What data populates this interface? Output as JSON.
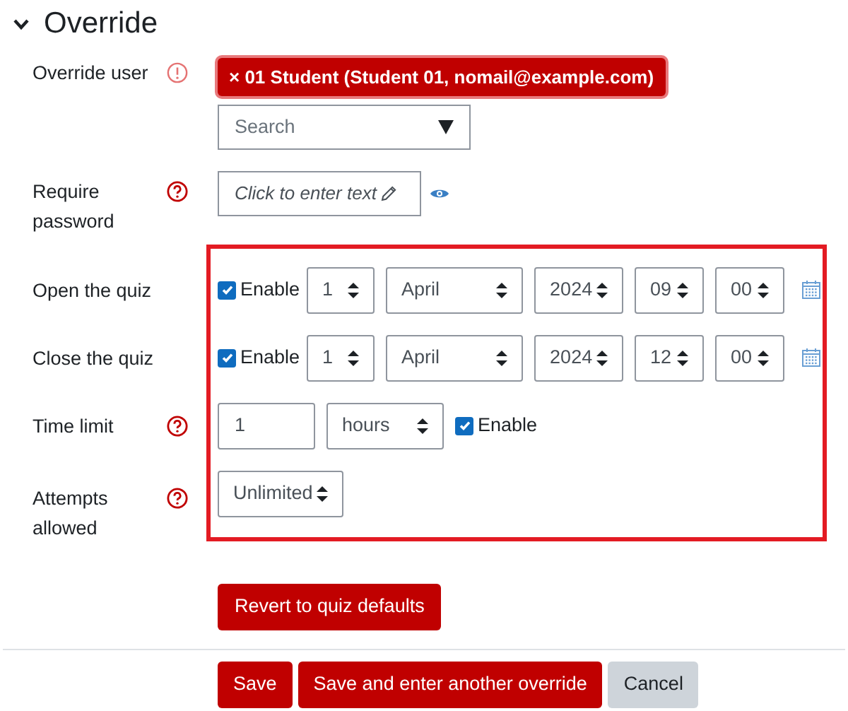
{
  "section": {
    "title": "Override",
    "expanded": true
  },
  "override_user": {
    "label": "Override user",
    "required": true,
    "selected_user": "× 01 Student (Student 01, nomail@example.com)",
    "search": {
      "placeholder": "Search"
    }
  },
  "require_password": {
    "label": "Require password",
    "help": true,
    "placeholder": "Click to enter text"
  },
  "highlighted": true,
  "timing_rows": [
    {
      "kind": "date",
      "label": "Open the quiz",
      "enable": {
        "label": "Enable",
        "checked": true
      },
      "day": "1",
      "month": "April",
      "year": "2024",
      "hour": "09",
      "minute": "00"
    },
    {
      "kind": "date",
      "label": "Close the quiz",
      "enable": {
        "label": "Enable",
        "checked": true
      },
      "day": "1",
      "month": "April",
      "year": "2024",
      "hour": "12",
      "minute": "00"
    },
    {
      "kind": "duration",
      "label": "Time limit",
      "help": true,
      "value": "1",
      "unit": "hours",
      "enable": {
        "label": "Enable",
        "checked": true
      }
    },
    {
      "kind": "attempts",
      "label": "Attempts allowed",
      "help": true,
      "value": "Unlimited"
    }
  ],
  "revert_button": "Revert to quiz defaults",
  "footer_buttons": [
    {
      "label": "Save",
      "kind": "primary"
    },
    {
      "label": "Save and enter another override",
      "kind": "primary"
    },
    {
      "label": "Cancel",
      "kind": "secondary"
    }
  ]
}
